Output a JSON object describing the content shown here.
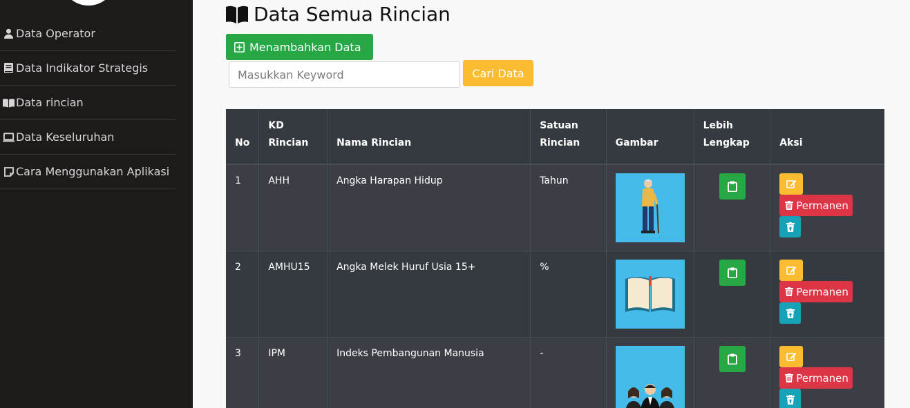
{
  "sidebar": {
    "items": [
      {
        "label": "Data Operator",
        "icon": "user-icon"
      },
      {
        "label": "Data Indikator Strategis",
        "icon": "book-icon"
      },
      {
        "label": "Data rincian",
        "icon": "open-book-icon"
      },
      {
        "label": "Data Keseluruhan",
        "icon": "laptop-icon"
      },
      {
        "label": "Cara Menggunakan Aplikasi",
        "icon": "sticky-note-icon"
      }
    ]
  },
  "main": {
    "title": "Data Semua Rincian",
    "add_button": "Menambahkan Data",
    "search": {
      "placeholder": "Masukkan Keyword",
      "value": ""
    },
    "search_button": "Cari Data"
  },
  "table": {
    "headers": {
      "no": "No",
      "kd_line1": "KD",
      "kd_line2": "Rincian",
      "nama": "Nama Rincian",
      "satuan_line1": "Satuan",
      "satuan_line2": "Rincian",
      "gambar": "Gambar",
      "lebih_line1": "Lebih",
      "lebih_line2": "Lengkap",
      "aksi": "Aksi"
    },
    "rows": [
      {
        "no": "1",
        "kd": "AHH",
        "nama": "Angka Harapan Hidup",
        "satuan": "Tahun",
        "image": "elderly-man-illustration",
        "delete_label": "Permanen"
      },
      {
        "no": "2",
        "kd": "AMHU15",
        "nama": "Angka Melek Huruf Usia 15+",
        "satuan": "%",
        "image": "open-book-illustration",
        "delete_label": "Permanen"
      },
      {
        "no": "3",
        "kd": "IPM",
        "nama": "Indeks Pembangunan Manusia",
        "satuan": "-",
        "image": "people-group-illustration",
        "delete_label": "Permanen"
      }
    ]
  },
  "colors": {
    "sidebar_bg": "#1e1a1a",
    "table_bg": "#343a40",
    "success": "#28a745",
    "warning": "#fbbc32",
    "danger": "#dc3545",
    "info": "#17a2b8",
    "image_bg": "#45bbe9"
  }
}
